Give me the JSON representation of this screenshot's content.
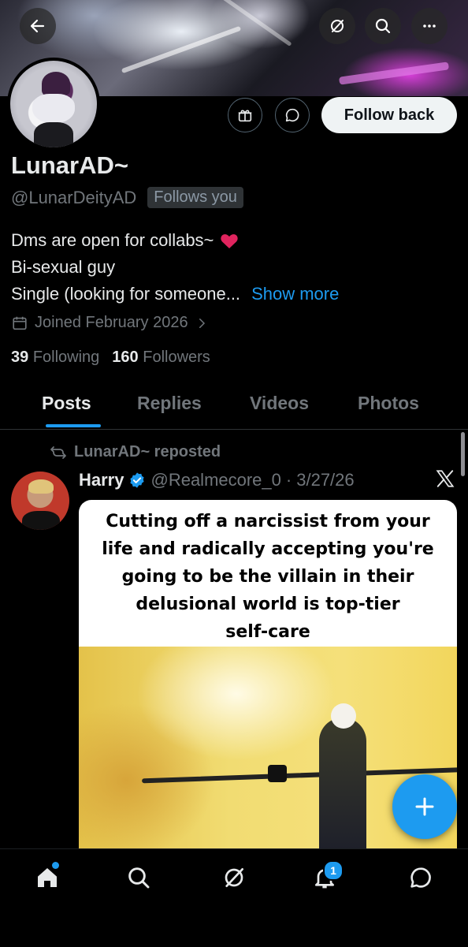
{
  "profile": {
    "display_name": "LunarAD~",
    "handle": "@LunarDeityAD",
    "follows_you_badge": "Follows you",
    "follow_button_label": "Follow back",
    "bio_lines": [
      "Dms are open for collabs~",
      "Bi-sexual guy",
      "Single (looking for someone..."
    ],
    "show_more_label": "Show more",
    "joined_text": "Joined February 2026",
    "following_count": "39",
    "following_label": "Following",
    "followers_count": "160",
    "followers_label": "Followers"
  },
  "tabs": [
    {
      "label": "Posts",
      "active": true
    },
    {
      "label": "Replies",
      "active": false
    },
    {
      "label": "Videos",
      "active": false
    },
    {
      "label": "Photos",
      "active": false
    }
  ],
  "post": {
    "repost_text": "LunarAD~ reposted",
    "author_name": "Harry",
    "author_handle": "@Realmecore_0",
    "separator": "·",
    "date": "3/27/26",
    "media_caption_lines": [
      "Cutting off a narcissist from your",
      "life and radically accepting you're",
      "going to be the villain in their",
      "delusional world is top-tier",
      "self-care"
    ]
  },
  "bottom_nav": {
    "notifications_badge": "1"
  },
  "colors": {
    "accent": "#1d9bf0",
    "background": "#000000",
    "muted_text": "#71767b",
    "heart": "#e0245e"
  },
  "icons": [
    "back-arrow-icon",
    "grok-icon",
    "search-icon",
    "more-icon",
    "gift-icon",
    "message-icon",
    "calendar-icon",
    "repost-icon",
    "verified-icon",
    "x-logo-icon",
    "compose-plus-icon",
    "home-icon",
    "notifications-icon",
    "chat-icon"
  ]
}
